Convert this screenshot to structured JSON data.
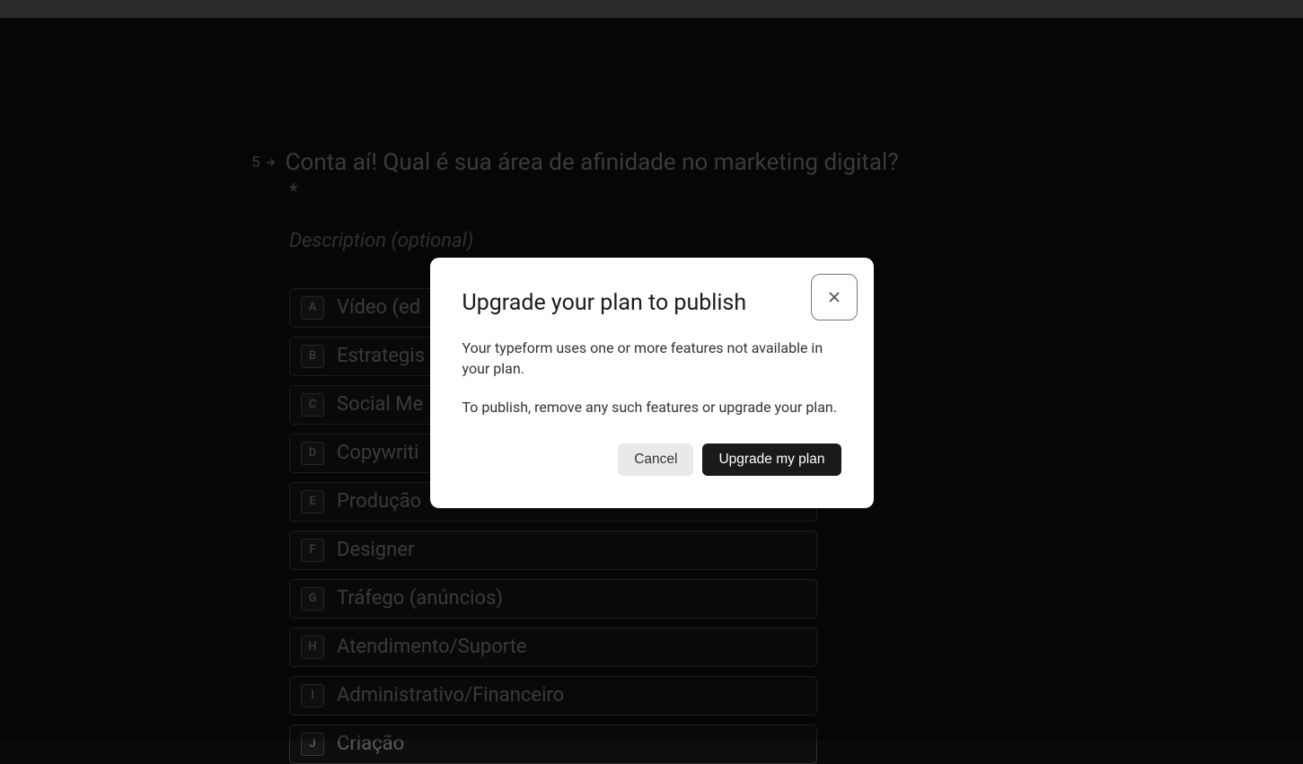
{
  "question": {
    "number": "5",
    "text": "Conta aí! Qual é sua área de afinidade no marketing digital?",
    "required_marker": "*",
    "description_placeholder": "Description (optional)"
  },
  "options": [
    {
      "key": "A",
      "label": "Vídeo (ed"
    },
    {
      "key": "B",
      "label": "Estrategis"
    },
    {
      "key": "C",
      "label": "Social Me"
    },
    {
      "key": "D",
      "label": "Copywriti"
    },
    {
      "key": "E",
      "label": "Produção"
    },
    {
      "key": "F",
      "label": "Designer"
    },
    {
      "key": "G",
      "label": "Tráfego (anúncios)"
    },
    {
      "key": "H",
      "label": "Atendimento/Suporte"
    },
    {
      "key": "I",
      "label": "Administrativo/Financeiro"
    },
    {
      "key": "J",
      "label": "Criação"
    }
  ],
  "modal": {
    "title": "Upgrade your plan to publish",
    "paragraph1": "Your typeform uses one or more features not available in your plan.",
    "paragraph2": "To publish, remove any such features or upgrade your plan.",
    "cancel_label": "Cancel",
    "upgrade_label": "Upgrade my plan"
  }
}
